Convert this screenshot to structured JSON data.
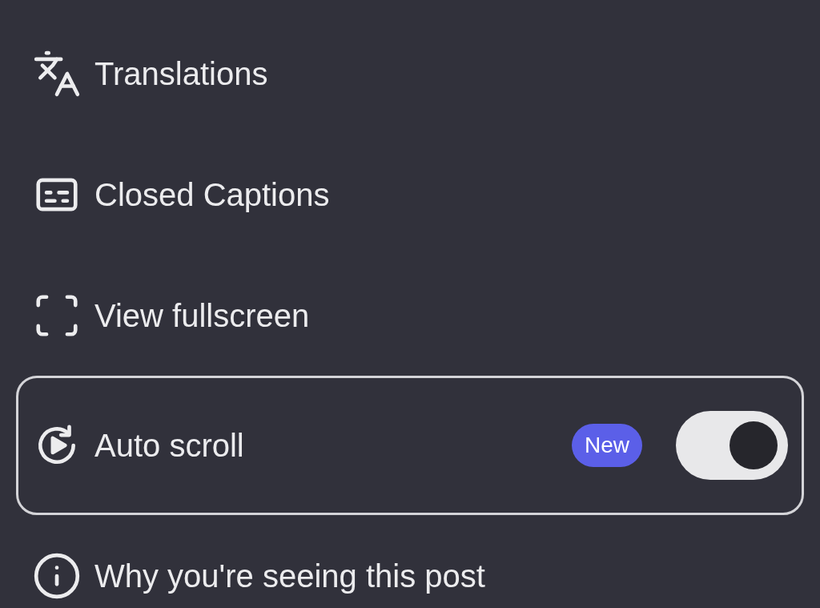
{
  "menu": {
    "items": [
      {
        "kind": "link",
        "label": "Translations",
        "selected": false
      },
      {
        "kind": "link",
        "label": "Closed Captions",
        "selected": false
      },
      {
        "kind": "link",
        "label": "View fullscreen",
        "selected": false
      },
      {
        "kind": "toggle",
        "label": "Auto scroll",
        "badge": "New",
        "on": true,
        "selected": true
      },
      {
        "kind": "link",
        "label": "Why you're seeing this post",
        "selected": false
      }
    ]
  }
}
